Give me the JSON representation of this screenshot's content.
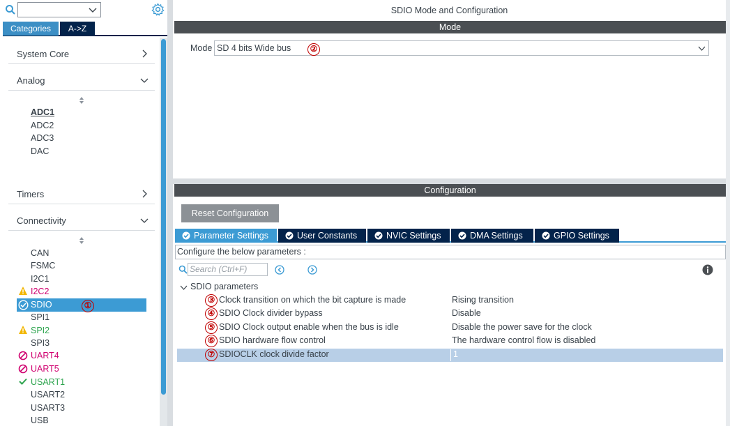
{
  "left_panel": {
    "search_value": "",
    "tabs": [
      {
        "label": "Categories"
      },
      {
        "label": "A->Z"
      }
    ],
    "groups": {
      "system_core": "System Core",
      "analog": "Analog",
      "timers": "Timers",
      "connectivity": "Connectivity"
    },
    "analog_items": [
      "ADC1",
      "ADC2",
      "ADC3",
      "DAC"
    ],
    "connectivity_items": [
      {
        "label": "CAN",
        "status": "none",
        "color": "#39424a"
      },
      {
        "label": "FSMC",
        "status": "none",
        "color": "#39424a"
      },
      {
        "label": "I2C1",
        "status": "none",
        "color": "#39424a"
      },
      {
        "label": "I2C2",
        "status": "warning",
        "color": "#d0006f"
      },
      {
        "label": "SDIO",
        "status": "enabled-selected",
        "color": "#ffffff"
      },
      {
        "label": "SPI1",
        "status": "none",
        "color": "#39424a"
      },
      {
        "label": "SPI2",
        "status": "warning",
        "color": "#2da44e"
      },
      {
        "label": "SPI3",
        "status": "none",
        "color": "#39424a"
      },
      {
        "label": "UART4",
        "status": "blocked",
        "color": "#d0006f"
      },
      {
        "label": "UART5",
        "status": "blocked",
        "color": "#d0006f"
      },
      {
        "label": "USART1",
        "status": "enabled",
        "color": "#2da44e"
      },
      {
        "label": "USART2",
        "status": "none",
        "color": "#39424a"
      },
      {
        "label": "USART3",
        "status": "none",
        "color": "#39424a"
      },
      {
        "label": "USB",
        "status": "none",
        "color": "#39424a"
      }
    ]
  },
  "right_panel": {
    "title": "SDIO Mode and Configuration",
    "mode_header": "Mode",
    "mode_label": "Mode",
    "mode_value": "SD 4 bits Wide bus",
    "config_header": "Configuration",
    "reset_button": "Reset Configuration",
    "settings_tabs": [
      {
        "label": "Parameter Settings",
        "active": true
      },
      {
        "label": "User Constants",
        "active": false
      },
      {
        "label": "NVIC Settings",
        "active": false
      },
      {
        "label": "DMA Settings",
        "active": false
      },
      {
        "label": "GPIO Settings",
        "active": false
      }
    ],
    "configure_text": "Configure the below parameters :",
    "search_placeholder": "Search (Ctrl+F)",
    "params_group": "SDIO parameters",
    "parameters": [
      {
        "name": "Clock transition on which the bit capture is made",
        "value": "Rising transition"
      },
      {
        "name": "SDIO Clock divider bypass",
        "value": "Disable"
      },
      {
        "name": "SDIO Clock output enable when the bus is idle",
        "value": "Disable the power save for the clock"
      },
      {
        "name": "SDIO hardware flow control",
        "value": "The hardware control flow is disabled"
      },
      {
        "name": "SDIOCLK clock divide factor",
        "value": "1"
      }
    ]
  },
  "annotations": [
    "①",
    "②",
    "③",
    "④",
    "⑤",
    "⑥",
    "⑦"
  ],
  "colors": {
    "accent": "#3c9bd4",
    "dark_navy": "#03234b",
    "header_bar": "#4b4f53",
    "selected_row": "#b8cfe7",
    "annotation_red": "#c00000"
  }
}
